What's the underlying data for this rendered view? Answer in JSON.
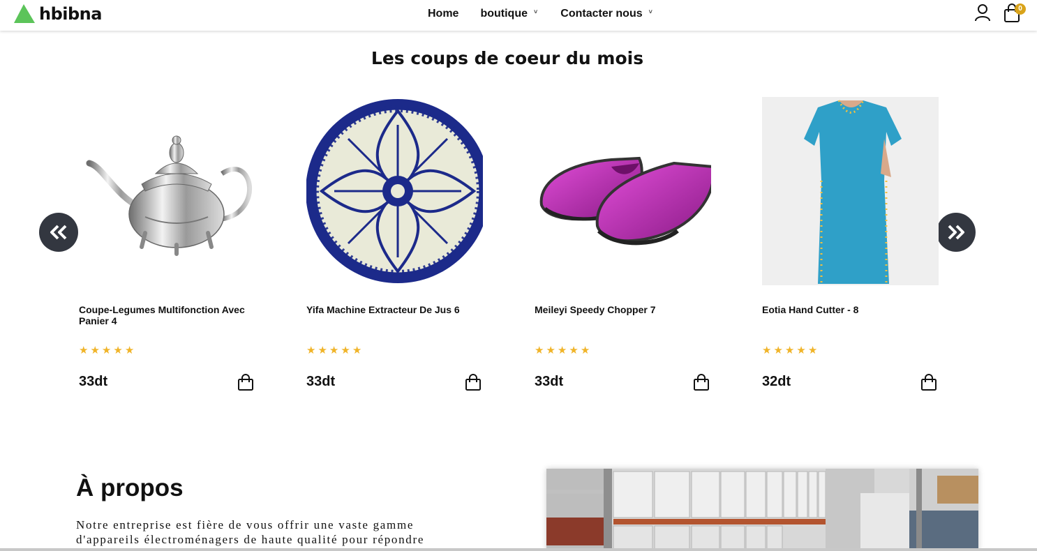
{
  "header": {
    "logo_text": "hbibna",
    "brand_color": "#5cc45a",
    "nav": [
      {
        "label": "Home"
      },
      {
        "label": "boutique",
        "caret": "˅"
      },
      {
        "label": "Contacter nous",
        "caret": "˅"
      }
    ],
    "cart_count": "0",
    "icons": [
      "user-icon",
      "shopping-bag-icon"
    ]
  },
  "featured": {
    "title": "Les coups de coeur du mois",
    "prev_icon": "double-chevron-left-icon",
    "next_icon": "double-chevron-right-icon",
    "products": [
      {
        "name": "Coupe-Legumes Multifonction Avec Panier 4",
        "price": "33dt",
        "rating": 5,
        "stars": "★★★★★",
        "image": "silver-teapot"
      },
      {
        "name": "Yifa Machine Extracteur De Jus 6",
        "price": "33dt",
        "rating": 5,
        "stars": "★★★★★",
        "image": "blue-ceramic-plate"
      },
      {
        "name": "Meileyi Speedy Chopper 7",
        "price": "33dt",
        "rating": 5,
        "stars": "★★★★★",
        "image": "pink-slippers"
      },
      {
        "name": "Eotia Hand Cutter - 8",
        "price": "32dt",
        "rating": 5,
        "stars": "★★★★★",
        "image": "blue-dress"
      }
    ]
  },
  "about": {
    "title": "À propos",
    "text": "Notre entreprise est fière de vous offrir une vaste gamme d'appareils électroménagers de haute qualité pour répondre",
    "image": "warehouse-shelves"
  },
  "colors": {
    "star": "#f0b429",
    "arrow_bg": "#333740",
    "badge": "#d9a31a"
  }
}
